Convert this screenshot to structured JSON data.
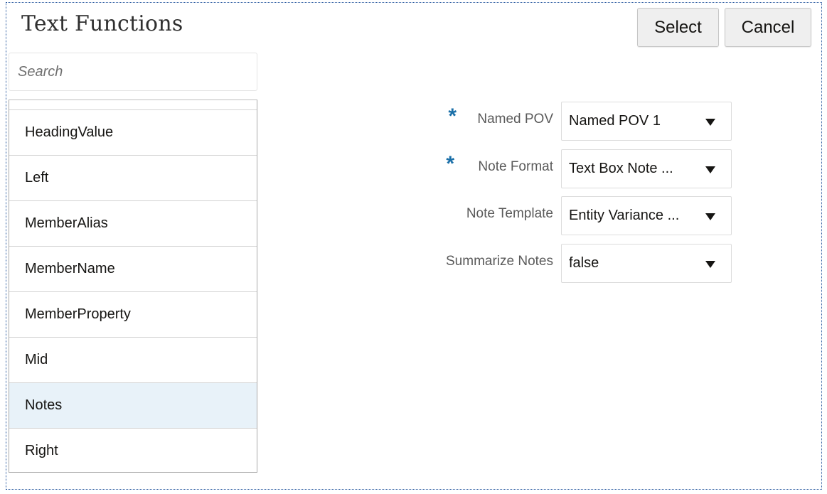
{
  "dialog": {
    "title": "Text Functions",
    "select_label": "Select",
    "cancel_label": "Cancel"
  },
  "search": {
    "placeholder": "Search",
    "value": ""
  },
  "function_list": {
    "items": [
      {
        "label": "HeadingValue",
        "selected": false
      },
      {
        "label": "Left",
        "selected": false
      },
      {
        "label": "MemberAlias",
        "selected": false
      },
      {
        "label": "MemberName",
        "selected": false
      },
      {
        "label": "MemberProperty",
        "selected": false
      },
      {
        "label": "Mid",
        "selected": false
      },
      {
        "label": "Notes",
        "selected": true
      },
      {
        "label": "Right",
        "selected": false
      }
    ]
  },
  "form": {
    "fields": [
      {
        "label": "Named POV",
        "required": true,
        "value": "Named POV 1"
      },
      {
        "label": "Note Format",
        "required": true,
        "value": "Text Box Note ..."
      },
      {
        "label": "Note Template",
        "required": false,
        "value": "Entity Variance ..."
      },
      {
        "label": "Summarize Notes",
        "required": false,
        "value": "false"
      }
    ],
    "required_marker": "*"
  },
  "icons": {
    "dropdown": "chevron-down-icon"
  },
  "colors": {
    "required_marker": "#1a6fa8",
    "selected_row": "#e8f2f9",
    "button_bg": "#efefef"
  }
}
